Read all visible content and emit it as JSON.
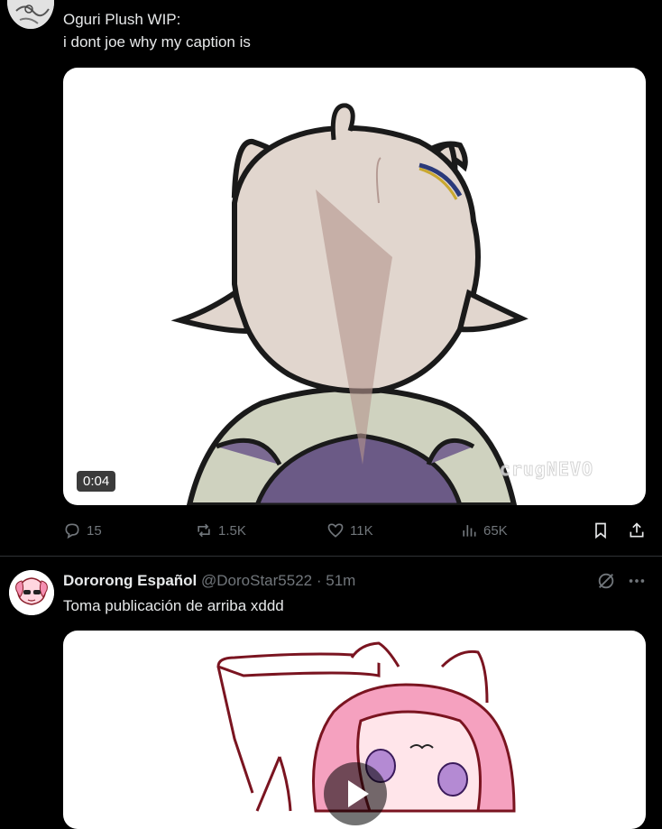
{
  "post1": {
    "title_line": "Oguri Plush WIP:",
    "caption_line": "i dont joe why my caption is",
    "video_duration": "0:04",
    "watermark": "crugNEVO",
    "stats": {
      "replies": "15",
      "reposts": "1.5K",
      "likes": "11K",
      "views": "65K"
    }
  },
  "post2": {
    "author_name": "Dororong Español",
    "handle": "@DoroStar5522",
    "separator": " · ",
    "time": "51m",
    "text": "Toma publicación de arriba xddd"
  },
  "icons": [
    "reply-icon",
    "repost-icon",
    "like-icon",
    "views-icon",
    "bookmark-icon",
    "share-icon",
    "grok-icon",
    "more-icon",
    "play-icon"
  ]
}
